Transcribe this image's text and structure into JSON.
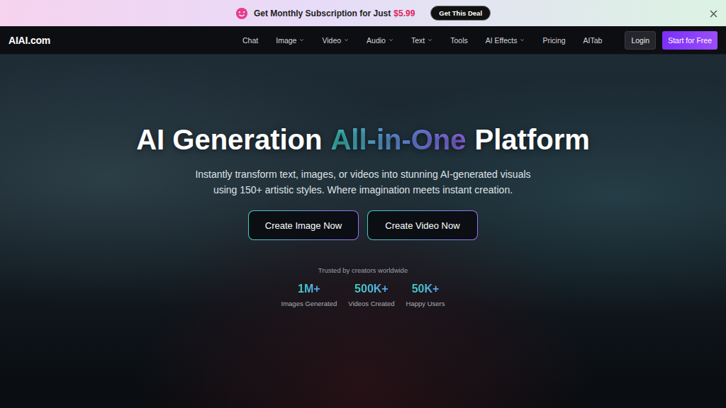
{
  "banner": {
    "text": "Get Monthly Subscription for Just",
    "price": "$5.99",
    "button": "Get This Deal"
  },
  "nav": {
    "logo": "AIAI.com",
    "items": [
      {
        "label": "Chat",
        "has_menu": false
      },
      {
        "label": "Image",
        "has_menu": true
      },
      {
        "label": "Video",
        "has_menu": true
      },
      {
        "label": "Audio",
        "has_menu": true
      },
      {
        "label": "Text",
        "has_menu": true
      },
      {
        "label": "Tools",
        "has_menu": false
      },
      {
        "label": "AI Effects",
        "has_menu": true
      },
      {
        "label": "Pricing",
        "has_menu": false
      },
      {
        "label": "AITab",
        "has_menu": false
      }
    ],
    "login": "Login",
    "start": "Start for Free"
  },
  "hero": {
    "title_before": "AI Generation",
    "title_highlight": "All-in-One",
    "title_after": "Platform",
    "subtitle": [
      "Instantly transform text, images, or videos into stunning AI-generated visuals",
      "using 150+ artistic styles. Where imagination meets instant creation."
    ],
    "buttons": [
      "Create Image Now",
      "Create Video Now"
    ],
    "trusted": "Trusted by creators worldwide",
    "stats": [
      {
        "value": "1M+",
        "label": "Images Generated"
      },
      {
        "value": "500K+",
        "label": "Videos Created"
      },
      {
        "value": "50K+",
        "label": "Happy Users"
      }
    ]
  }
}
